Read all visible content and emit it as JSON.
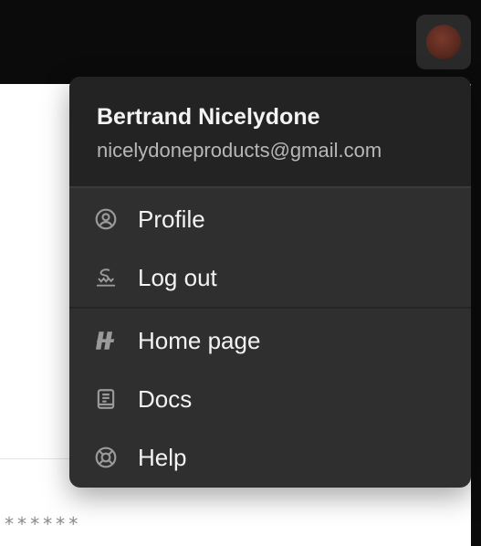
{
  "background": {
    "masked_value": "******"
  },
  "account_menu": {
    "user_name": "Bertrand Nicelydone",
    "user_email": "nicelydoneproducts@gmail.com",
    "account_items": [
      {
        "label": "Profile",
        "icon": "user-circle-icon"
      },
      {
        "label": "Log out",
        "icon": "logout-icon"
      }
    ],
    "resource_items": [
      {
        "label": "Home page",
        "icon": "brand-logo-icon"
      },
      {
        "label": "Docs",
        "icon": "book-icon"
      },
      {
        "label": "Help",
        "icon": "lifebuoy-icon"
      }
    ]
  },
  "colors": {
    "menu_background": "#2f2f2f",
    "menu_header_background": "#232323",
    "topbar_background": "#0b0b0b",
    "text_primary": "#f3f3f3",
    "text_secondary": "#b7b7b7",
    "icon_color": "#9a9a9a"
  }
}
